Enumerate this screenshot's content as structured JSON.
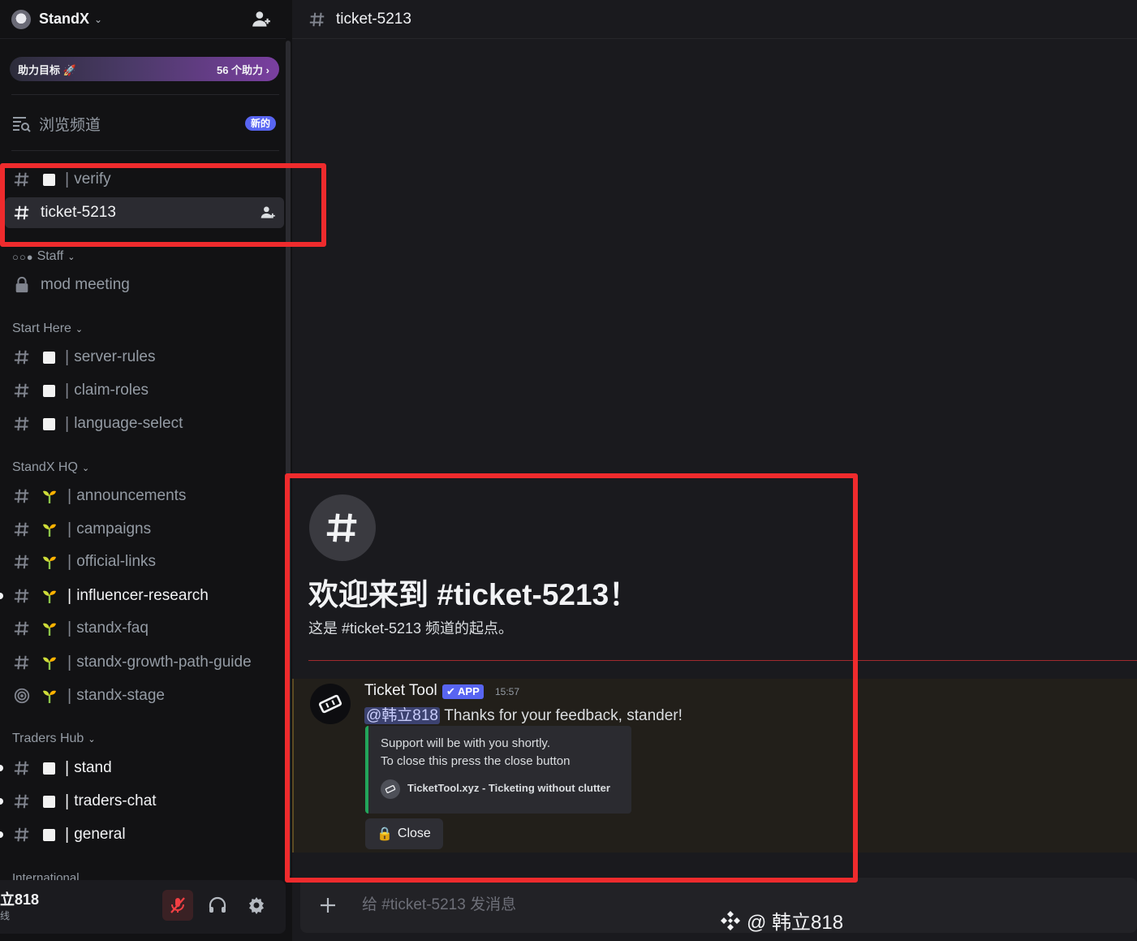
{
  "server": {
    "name": "StandX",
    "chevron": "⌄"
  },
  "boost": {
    "label": "助力目标",
    "count": "56 个助力 ›"
  },
  "browse": {
    "label": "浏览频道",
    "badge": "新的"
  },
  "channels_top": [
    {
      "name": "verify",
      "prefix": "|"
    },
    {
      "name": "ticket-5213"
    }
  ],
  "categories": {
    "staff": "Staff",
    "start_here": "Start Here",
    "hq": "StandX HQ",
    "traders": "Traders Hub",
    "international": "International"
  },
  "staff_channel": "mod meeting",
  "start_here": [
    "server-rules",
    "claim-roles",
    "language-select"
  ],
  "hq": [
    "announcements",
    "campaigns",
    "official-links",
    "influencer-research",
    "standx-faq",
    "standx-growth-path-guide",
    "standx-stage"
  ],
  "traders": [
    "stand",
    "traders-chat",
    "general"
  ],
  "pipe": "|",
  "user": {
    "name": "立818",
    "status": "线"
  },
  "header": {
    "channel": "ticket-5213"
  },
  "welcome": {
    "title": "欢迎来到 #ticket-5213！",
    "subtitle": "这是 #ticket-5213 频道的起点。"
  },
  "message": {
    "author": "Ticket Tool",
    "tag": "✔ APP",
    "time": "15:57",
    "mention": "@韩立818",
    "text": " Thanks for your feedback, stander!",
    "embed": {
      "line1": "Support will be with you shortly.",
      "line2": "To close this press the close button",
      "footer": "TicketTool.xyz - Ticketing without clutter",
      "color": "#23a55a"
    },
    "button": {
      "emoji": "🔒",
      "label": "Close"
    }
  },
  "composer": {
    "placeholder": "给 #ticket-5213 发消息"
  },
  "watermark": "@ 韩立818",
  "colors": {
    "accent": "#5865f2",
    "highlight": "#ef2b2d",
    "online": "#23a55a"
  }
}
